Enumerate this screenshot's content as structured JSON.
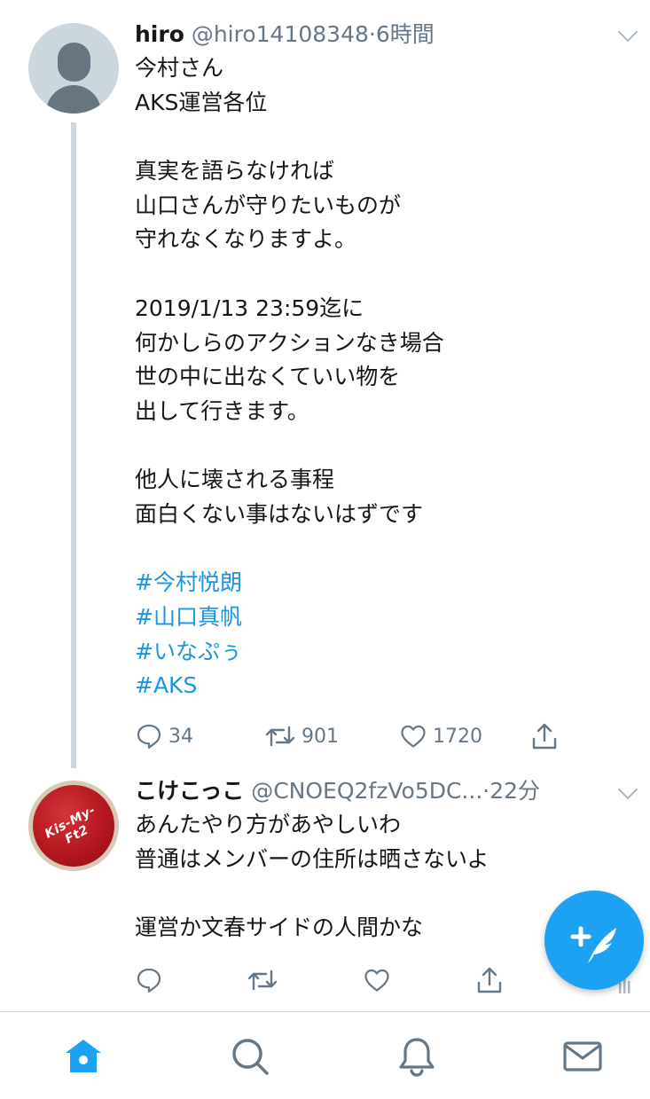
{
  "tweets": [
    {
      "name": "hiro",
      "handle": "@hiro14108348",
      "separator": "·",
      "time": "6時間",
      "lines": [
        "今村さん",
        "AKS運営各位",
        "",
        "真実を語らなければ",
        "山口さんが守りたいものが",
        "守れなくなりますよ。",
        "",
        "2019/1/13 23:59迄に",
        "何かしらのアクションなき場合",
        "世の中に出なくていい物を",
        "出して行きます。",
        "",
        "他人に壊される事程",
        "面白くない事はないはずです",
        ""
      ],
      "hashtags": [
        "#今村悦朗",
        "#山口真帆",
        "#いなぷぅ",
        "#AKS"
      ],
      "replies": "34",
      "retweets": "901",
      "likes": "1720"
    },
    {
      "name": "こけこっこ",
      "handle": "@CNOEQ2fzVo5DC...",
      "separator": "·",
      "time": "22分",
      "avatar_text": "Kis-My-Ft2",
      "lines": [
        "あんたやり方があやしいわ",
        "普通はメンバーの住所は晒さないよ",
        "",
        "運営か文春サイドの人間かな"
      ],
      "replies": "",
      "retweets": "",
      "likes": ""
    }
  ],
  "icons": {
    "reply": "speech-bubble-icon",
    "retweet": "retweet-arrows-icon",
    "like": "heart-outline-icon",
    "share": "share-upload-icon",
    "compose": "compose-feather-icon",
    "home": "home-icon",
    "search": "search-icon",
    "notifications": "bell-icon",
    "messages": "envelope-icon"
  },
  "colors": {
    "accent": "#1da1f2",
    "hashtag": "#1b95e0",
    "secondary_text": "#657786",
    "icon_gray": "#657786",
    "tab_inactive": "#657786",
    "tab_active": "#1da1f2"
  }
}
